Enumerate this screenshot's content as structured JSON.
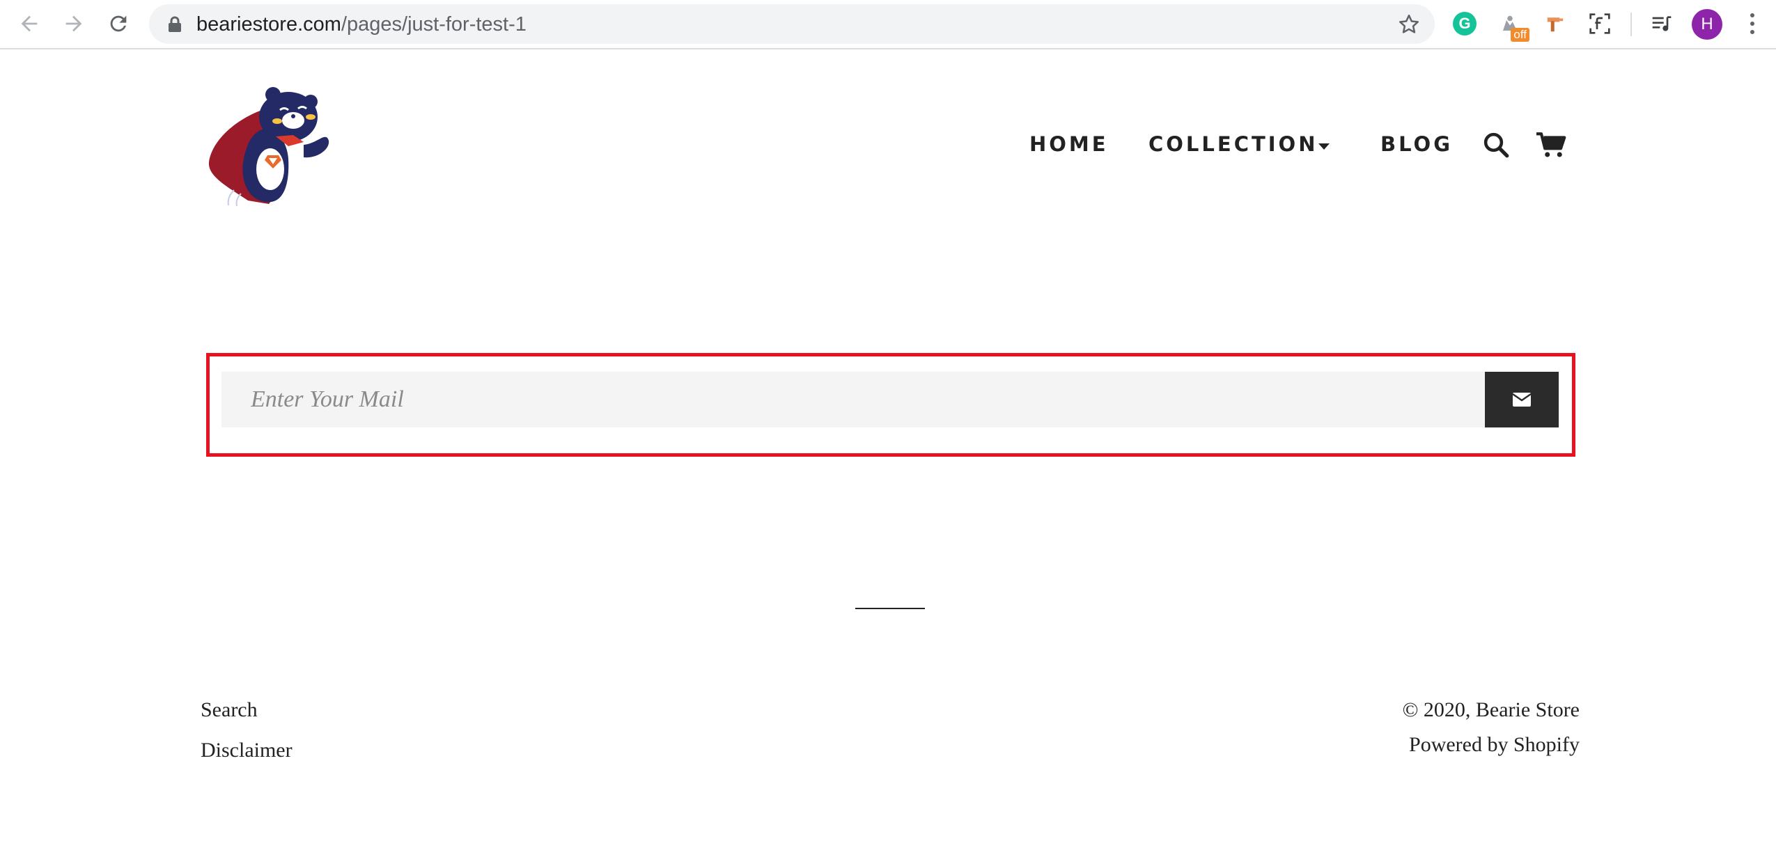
{
  "browser": {
    "url_host": "beariestore.com",
    "url_path": "/pages/just-for-test-1",
    "profile_initial": "H",
    "extensions": {
      "grammarly_letter": "G",
      "off_badge": "off"
    },
    "icons": [
      "back-arrow-icon",
      "forward-arrow-icon",
      "reload-icon",
      "lock-icon",
      "star-icon",
      "grammarly-icon",
      "extension-off-icon",
      "hammer-tool-icon",
      "font-f-icon",
      "media-queue-icon",
      "kebab-menu-icon"
    ]
  },
  "site": {
    "nav": {
      "home": "HOME",
      "collection": "COLLECTION",
      "blog": "BLOG"
    },
    "icons": [
      "bear-logo-icon",
      "caret-down-icon",
      "search-icon",
      "cart-icon",
      "envelope-icon"
    ]
  },
  "newsletter": {
    "placeholder": "Enter Your Mail",
    "highlight_color": "#e8111f"
  },
  "footer": {
    "links": [
      "Search",
      "Disclaimer"
    ],
    "copyright": "© 2020, Bearie Store",
    "powered": "Powered by Shopify"
  },
  "colors": {
    "button_dark": "#2b2b2b",
    "input_bg": "#f4f4f4",
    "avatar": "#8e24aa",
    "grammarly": "#15c39a"
  }
}
